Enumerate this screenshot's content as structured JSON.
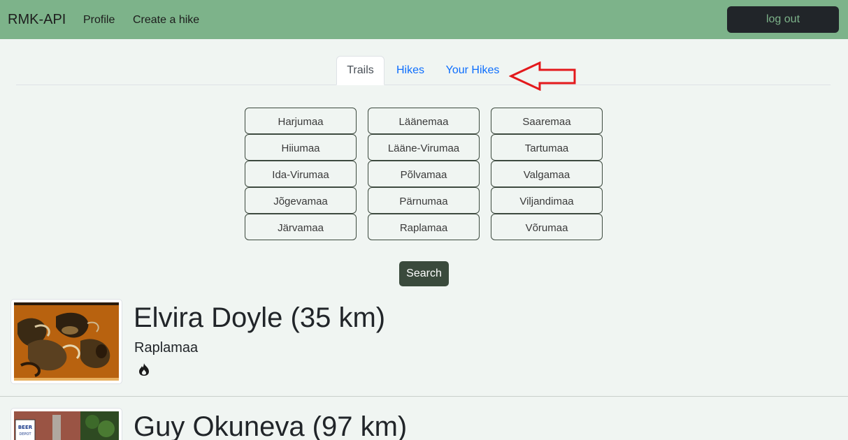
{
  "navbar": {
    "brand": "RMK-API",
    "links": [
      "Profile",
      "Create a hike"
    ],
    "logout": "log out",
    "bg_color": "#7db38a"
  },
  "tabs": [
    {
      "label": "Trails",
      "active": true
    },
    {
      "label": "Hikes",
      "active": false
    },
    {
      "label": "Your Hikes",
      "active": false
    }
  ],
  "annotation": {
    "icon": "red-arrow-icon",
    "color": "#e3191c"
  },
  "counties": {
    "col1": [
      "Harjumaa",
      "Hiiumaa",
      "Ida-Virumaa",
      "Jõgevamaa",
      "Järvamaa"
    ],
    "col2": [
      "Läänemaa",
      "Lääne-Virumaa",
      "Põlvamaa",
      "Pärnumaa",
      "Raplamaa"
    ],
    "col3": [
      "Saaremaa",
      "Tartumaa",
      "Valgamaa",
      "Viljandimaa",
      "Võrumaa"
    ]
  },
  "search_label": "Search",
  "trails": [
    {
      "title": "Elvira Doyle (35 km)",
      "county": "Raplamaa",
      "icon": "fire-icon"
    },
    {
      "title": "Guy Okuneva (97 km)",
      "sign_text": "BEER DEPOT"
    }
  ]
}
